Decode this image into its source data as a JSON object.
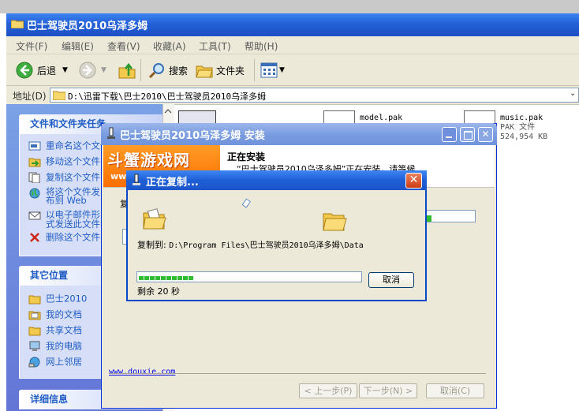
{
  "explorer": {
    "title": "巴士驾驶员2010乌泽多姆",
    "menu": [
      "文件(F)",
      "编辑(E)",
      "查看(V)",
      "收藏(A)",
      "工具(T)",
      "帮助(H)"
    ],
    "toolbar": {
      "back": "后退",
      "search": "搜索",
      "folders": "文件夹"
    },
    "address": {
      "label": "地址(D)",
      "path": "D:\\迅雷下载\\巴士2010\\巴士驾驶员2010乌泽多姆"
    },
    "tasks_panel": {
      "title": "文件和文件夹任务",
      "items": [
        "重命名这个文件",
        "移动这个文件",
        "复制这个文件",
        "将这个文件发布到 Web",
        "以电子邮件形式发送此文件",
        "删除这个文件"
      ]
    },
    "other_panel": {
      "title": "其它位置",
      "items": [
        "巴士2010",
        "我的文档",
        "共享文档",
        "我的电脑",
        "网上邻居"
      ]
    },
    "details_panel": {
      "title": "详细信息"
    },
    "files": [
      {
        "name": "model.pak"
      },
      {
        "name": "music.pak",
        "type": "PAK 文件",
        "size": "524,954 KB"
      }
    ]
  },
  "installer": {
    "title": "巴士驾驶员2010乌泽多姆  安装",
    "logo": "斗蟹游戏网",
    "logo_sub": "ww",
    "heading": "正在安装",
    "description": "“巴士驾驶员2010乌泽多姆”正在安装，请等候...",
    "side_label": "复",
    "link": "www.douxie.com",
    "buttons": {
      "back": "< 上一步(P)",
      "next": "下一步(N) >",
      "cancel": "取消(C)"
    }
  },
  "copy_dialog": {
    "title": "正在复制...",
    "copy_to_label": "复制到:",
    "copy_to_path": "D:\\Program Files\\巴士驾驶员2010乌泽多姆\\Data",
    "remaining": "剩余 20 秒",
    "cancel": "取消",
    "progress": 0.25
  },
  "colors": {
    "xp_title_blue": "#2461d6",
    "task_pane": "#6375d6",
    "link_blue": "#215dc6",
    "progress_green": "#2fbd2f",
    "logo_orange": "#ff7f00"
  }
}
